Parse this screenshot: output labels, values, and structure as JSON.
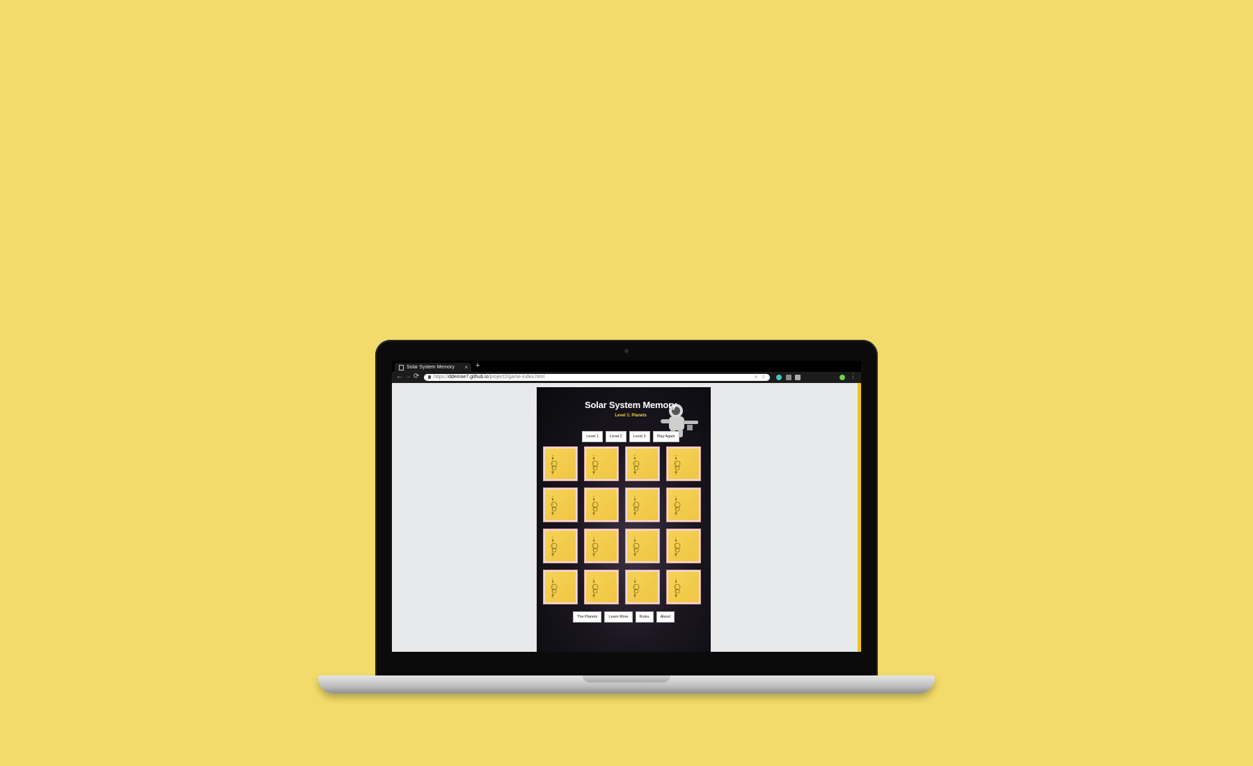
{
  "browser": {
    "tab_title": "Solar System Memory",
    "tab_close": "×",
    "new_tab": "+",
    "url_scheme": "https://",
    "url_host": "ddemoe7.github.io",
    "url_path": "/project2/game-index.html",
    "nav": {
      "back": "←",
      "forward": "→",
      "reload": "⟳"
    },
    "zoom_icon": "⌕",
    "star_icon": "☆",
    "menu": "⋮"
  },
  "game": {
    "title": "Solar System Memory",
    "level": "Level 1: Planets",
    "level_buttons": [
      "Level 1",
      "Level 2",
      "Level 3",
      "Play Again"
    ],
    "footer_buttons": [
      "The Planets",
      "Learn More",
      "Rules",
      "About"
    ],
    "card_count": 16,
    "card_back_icon": "solar-system-icon"
  },
  "colors": {
    "background": "#f2db6a",
    "card": "#f5d356",
    "level_text": "#f2d24a"
  }
}
